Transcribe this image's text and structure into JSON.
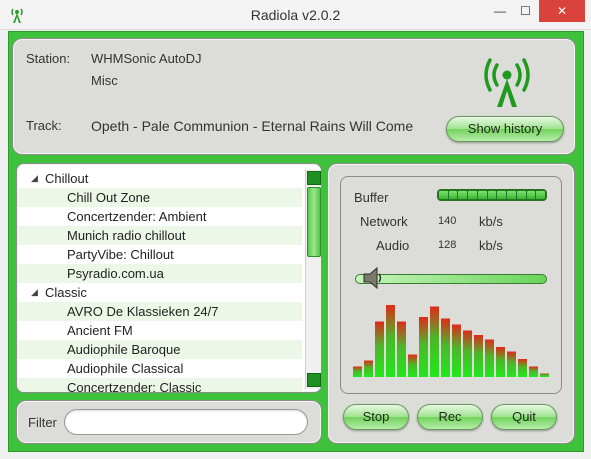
{
  "window": {
    "title": "Radiola v2.0.2",
    "min_glyph": "—",
    "max_glyph": "☐",
    "close_glyph": "✕"
  },
  "station": {
    "label": "Station:",
    "name": "WHMSonic AutoDJ",
    "genre": "Misc",
    "track_label": "Track:",
    "track": "Opeth - Pale Communion - Eternal Rains Will Come",
    "history_button": "Show history"
  },
  "stations_tree": [
    {
      "type": "group",
      "label": "Chillout",
      "expanded": true
    },
    {
      "type": "leaf",
      "label": "Chill Out Zone"
    },
    {
      "type": "leaf",
      "label": "Concertzender: Ambient"
    },
    {
      "type": "leaf",
      "label": "Munich radio chillout"
    },
    {
      "type": "leaf",
      "label": "PartyVibe: Chillout"
    },
    {
      "type": "leaf",
      "label": "Psyradio.com.ua"
    },
    {
      "type": "group",
      "label": "Classic",
      "expanded": true
    },
    {
      "type": "leaf",
      "label": "AVRO De Klassieken 24/7"
    },
    {
      "type": "leaf",
      "label": "Ancient FM"
    },
    {
      "type": "leaf",
      "label": "Audiophile Baroque"
    },
    {
      "type": "leaf",
      "label": "Audiophile Classical"
    },
    {
      "type": "leaf",
      "label": "Concertzender: Classic"
    }
  ],
  "filter": {
    "label": "Filter",
    "value": "",
    "placeholder": ""
  },
  "stats": {
    "buffer_label": "Buffer",
    "buffer_level": 1.0,
    "network_label": "Network",
    "network_value": "140",
    "network_unit": "kb/s",
    "audio_label": "Audio",
    "audio_value": "128",
    "audio_unit": "kb/s",
    "volume_level": 0.05
  },
  "spectrum_levels": [
    0.14,
    0.22,
    0.74,
    0.96,
    0.74,
    0.3,
    0.8,
    0.94,
    0.78,
    0.7,
    0.62,
    0.56,
    0.5,
    0.4,
    0.34,
    0.24,
    0.14,
    0.05
  ],
  "controls": {
    "stop": "Stop",
    "rec": "Rec",
    "quit": "Quit"
  },
  "colors": {
    "accent": "#3fc23b",
    "close": "#d9433c",
    "spectrum_low": "#22e81c",
    "spectrum_high": "#e02a18"
  }
}
